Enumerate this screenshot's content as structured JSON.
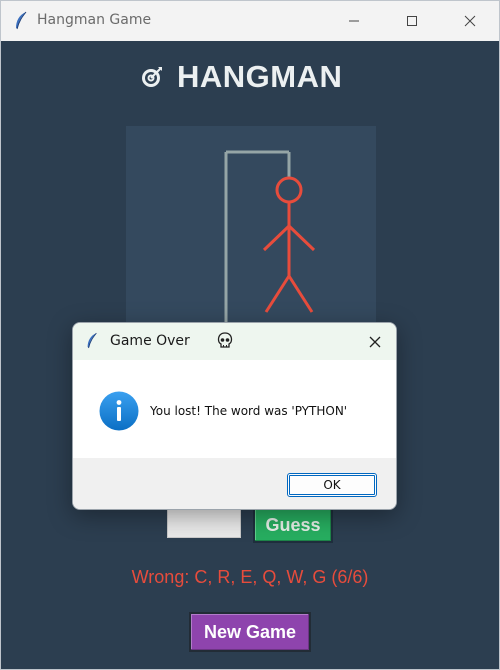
{
  "window": {
    "title": "Hangman Game",
    "app_icon": "feather-icon",
    "controls": [
      "minimize-icon",
      "maximize-icon",
      "close-icon"
    ]
  },
  "game": {
    "heading_icon": "target-icon",
    "heading": "HANGMAN",
    "guess_label": "Guess",
    "entry_value": "",
    "wrong_text": "Wrong: C, R, E, Q, W, G (6/6)",
    "new_game_label": "New Game",
    "colors": {
      "background": "#2c3e50",
      "canvas": "#34495e",
      "gallows": "#95a5a6",
      "figure": "#e74c3c",
      "guess_button": "#27ae60",
      "new_game_button": "#8e44ad",
      "wrong_text": "#e74c3c"
    }
  },
  "dialog": {
    "title": "Game Over",
    "title_icon": "skull-icon",
    "icon": "info-icon",
    "message": "You lost! The word was 'PYTHON'",
    "ok_label": "OK"
  }
}
